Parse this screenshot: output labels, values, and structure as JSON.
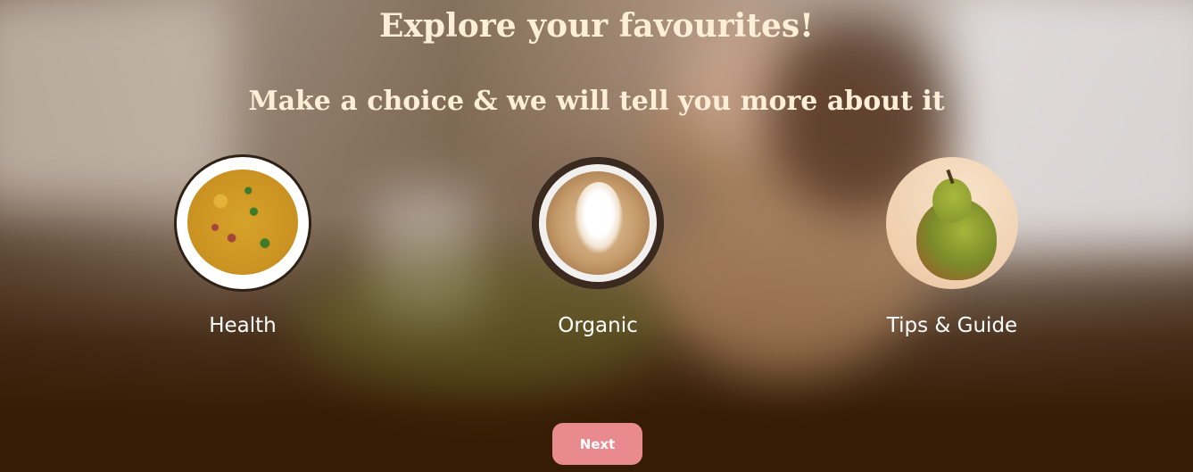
{
  "header": {
    "title": "Explore your favourites!",
    "subtitle": "Make a choice & we will tell you more about it"
  },
  "categories": [
    {
      "label": "Health",
      "image": "plate-of-yellow-rice"
    },
    {
      "label": "Organic",
      "image": "latte-coffee-cup"
    },
    {
      "label": "Tips & Guide",
      "image": "green-pear"
    }
  ],
  "actions": {
    "next_label": "Next"
  },
  "colors": {
    "heading_text": "#fdeed8",
    "background_dark": "#361c04",
    "button": "#e98a8f",
    "button_text": "#ffffff"
  }
}
